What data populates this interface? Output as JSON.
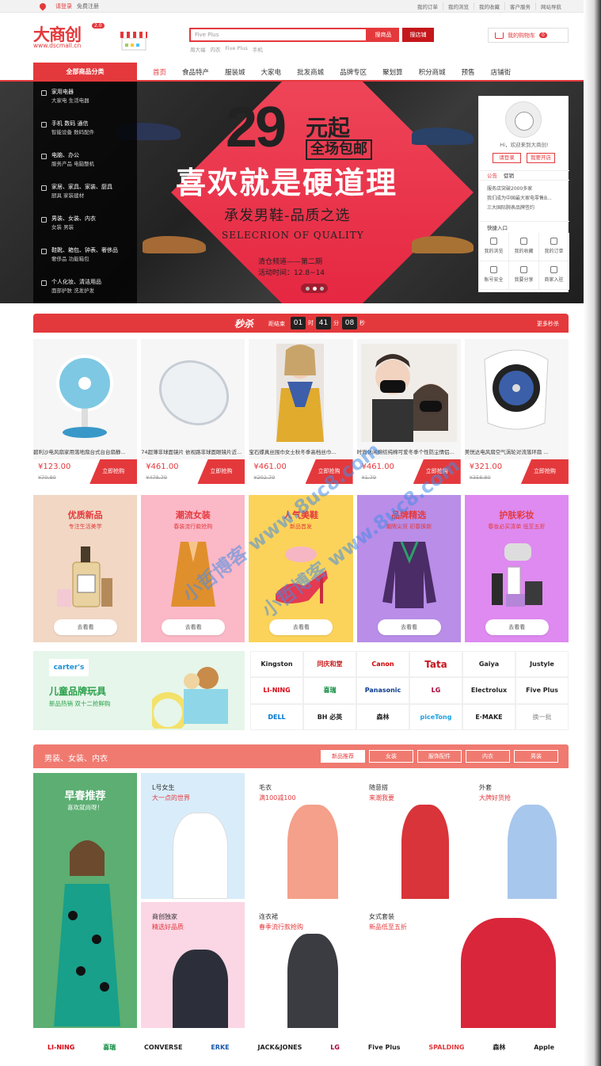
{
  "topbar": {
    "login": "请登录",
    "register": "免费注册",
    "links": [
      "我的订单",
      "我的浏览",
      "我的收藏",
      "客户服务",
      "网站导航"
    ]
  },
  "header": {
    "logo": "大商创",
    "version": "2.0",
    "url": "www.dscmall.cn",
    "search_placeholder": "Five Plus",
    "btn_goods": "搜商品",
    "btn_store": "搜店铺",
    "hotwords": [
      "周大福",
      "内衣",
      "Five Plus",
      "手机"
    ],
    "cart_label": "我的购物车",
    "cart_count": "0"
  },
  "nav": {
    "all_categories": "全部商品分类",
    "items": [
      "首页",
      "食品特产",
      "服装城",
      "大家电",
      "批发商城",
      "品牌专区",
      "聚划算",
      "积分商城",
      "预售",
      "店铺街"
    ]
  },
  "categories": [
    {
      "title": "家用电器",
      "sub": "大家电   生活电器"
    },
    {
      "title": "手机   数码   通信",
      "sub": "智能设备   数码配件"
    },
    {
      "title": "电脑、办公",
      "sub": "服务产品   电脑整机"
    },
    {
      "title": "家居、家具、家装、厨具",
      "sub": "厨具   家装建材"
    },
    {
      "title": "男装、女装、内衣",
      "sub": "女装   男装"
    },
    {
      "title": "鞋靴、箱包、钟表、奢侈品",
      "sub": "奢侈品   功能箱包"
    },
    {
      "title": "个人化妆、清洁用品",
      "sub": "面部护肤   洗发护发"
    }
  ],
  "banner": {
    "num": "29",
    "unit": "元起",
    "free": "全场包邮",
    "main": "喜欢就是硬道理",
    "sub": "承发男鞋-品质之选",
    "eng": "SELECRION OF QUALITY",
    "line1": "清仓频道——第二期",
    "line2": "活动时间：12.8~14"
  },
  "user_panel": {
    "welcome": "Hi，欢迎来到大商创!",
    "login": "请登录",
    "open_store": "我要开店",
    "tabs": [
      "公告",
      "促销"
    ],
    "notices": [
      "服务店突破2000多家",
      "我们成为中国最大家电零售B...",
      "三大国际腕表品牌签约"
    ],
    "quick_title": "快捷入口",
    "quick": [
      "我的浏览",
      "我的收藏",
      "我的订单",
      "账号安全",
      "我要分享",
      "商家入驻"
    ]
  },
  "seckill": {
    "logo": "秒杀",
    "label": "距结束",
    "h": "01",
    "m": "41",
    "s": "08",
    "sep_h": "时",
    "sep_m": "分",
    "sep_s": "秒",
    "more": "更多秒杀"
  },
  "products": [
    {
      "name": "碧利沙电风扇家用落地扇台式台台扇静...",
      "price": "¥123.00",
      "old": "¥70.80",
      "buy": "立即抢购"
    },
    {
      "name": "74超薄非球面镜片 依视路非球面眼镜片近...",
      "price": "¥461.00",
      "old": "¥478.79",
      "buy": "立即抢购"
    },
    {
      "name": "宝石蝶真丝围巾女士秋冬季高档丝巾...",
      "price": "¥461.00",
      "old": "¥202.79",
      "buy": "立即抢购"
    },
    {
      "name": "时尚休闲棉纺纯棉可爱冬季个性防尘情侣...",
      "price": "¥461.00",
      "old": "¥1.79",
      "buy": "立即抢购"
    },
    {
      "name": "美悦达电风扇空气涡轮对流落环扇 ...",
      "price": "¥321.00",
      "old": "¥358.80",
      "buy": "立即抢购"
    }
  ],
  "promos": [
    {
      "title": "优质新品",
      "sub": "专注生活美学",
      "btn": "去看看",
      "bg": "#f1d7c4"
    },
    {
      "title": "潮流女装",
      "sub": "春装流行款抢购",
      "btn": "去看看",
      "bg": "#fbb8c7"
    },
    {
      "title": "人气美鞋",
      "sub": "新品首发",
      "btn": "去看看",
      "bg": "#fbd35a"
    },
    {
      "title": "品牌精选",
      "sub": "潮牌尖货 初春换新",
      "btn": "去看看",
      "bg": "#b98de8"
    },
    {
      "title": "护肤彩妆",
      "sub": "春妆必买清单 低至五折",
      "btn": "去看看",
      "bg": "#de8af0"
    }
  ],
  "kids": {
    "tag": "carter's",
    "title": "儿童品牌玩具",
    "sub": "新品热销 双十二抢鲜购"
  },
  "brands": [
    "Kingston",
    "同庆和堂",
    "Canon",
    "Tata",
    "Gaiya",
    "Justyle",
    "LI-NING",
    "喜瑞",
    "Panasonic",
    "LG",
    "Electrolux",
    "Five Plus",
    "DELL",
    "BH 必英",
    "森林",
    "piceTong",
    "E·MAKE",
    "换一批"
  ],
  "women": {
    "title": "男装、女装、内衣",
    "tabs": [
      "新品推荐",
      "女装",
      "服饰配件",
      "内衣",
      "男装"
    ],
    "spring_title": "早春推荐",
    "spring_sub": "喜欢就尚呀！",
    "cells": [
      {
        "name": "L号女生",
        "desc": "大一点的世界"
      },
      {
        "name": "毛衣",
        "desc": "满100减100"
      },
      {
        "name": "随意搭",
        "desc": "来潮我要"
      },
      {
        "name": "外套",
        "desc": "大牌好货抢"
      },
      {
        "name": "商创独家",
        "desc": "精选好品质"
      },
      {
        "name": "连衣裙",
        "desc": "春季流行款抢购"
      },
      {
        "name": "女式套装",
        "desc": "新品低至五折"
      }
    ]
  },
  "bottom_brands": [
    "LI-NING",
    "喜瑞",
    "CONVERSE",
    "ERKE",
    "JACK&JONES",
    "LG",
    "Five Plus",
    "SPALDING",
    "森林",
    "Apple"
  ],
  "watermark": "小哲博客 www.8uc8.com"
}
